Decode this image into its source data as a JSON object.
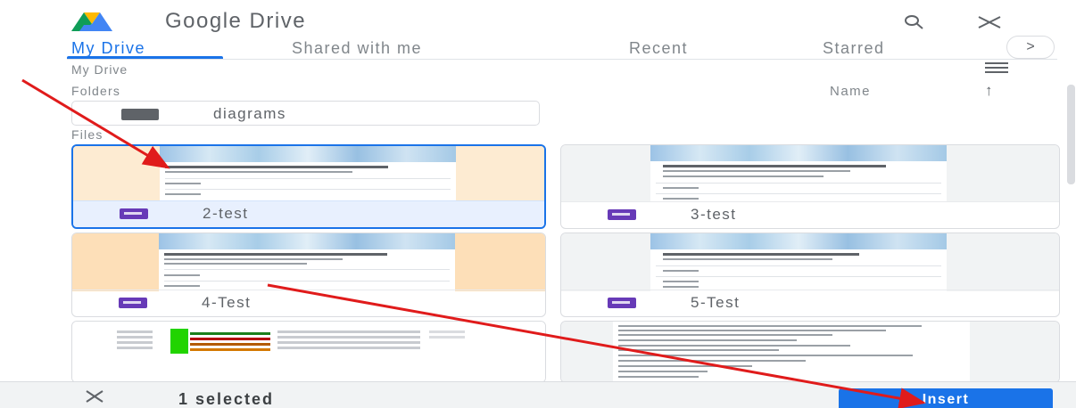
{
  "header": {
    "title": "Google Drive",
    "logo_icon": "google-drive-logo",
    "search_icon": "search-icon",
    "close_icon": "close-icon"
  },
  "tabs": [
    {
      "label": "My Drive",
      "active": true
    },
    {
      "label": "Shared with me",
      "active": false
    },
    {
      "label": "Recent",
      "active": false
    },
    {
      "label": "Starred",
      "active": false
    }
  ],
  "tab_scroll_icon": ">",
  "breadcrumb": "My Drive",
  "folders_section": {
    "label": "Folders",
    "sort_label": "Name",
    "sort_icon": "↑",
    "items": [
      {
        "name": "diagrams"
      }
    ]
  },
  "files_section": {
    "label": "Files",
    "items": [
      {
        "name": "2-test",
        "type": "form",
        "selected": true
      },
      {
        "name": "3-test",
        "type": "form",
        "selected": false
      },
      {
        "name": "4-Test",
        "type": "form",
        "selected": false
      },
      {
        "name": "5-Test",
        "type": "form",
        "selected": false
      },
      {
        "name": "",
        "type": "spreadsheet",
        "selected": false
      },
      {
        "name": "",
        "type": "document",
        "selected": false
      }
    ]
  },
  "bottom_bar": {
    "selected_text": "1 selected",
    "insert_label": "Insert"
  },
  "colors": {
    "accent": "#1a73e8",
    "form_icon": "#673ab7",
    "annotation_arrow": "#e01b1b"
  }
}
